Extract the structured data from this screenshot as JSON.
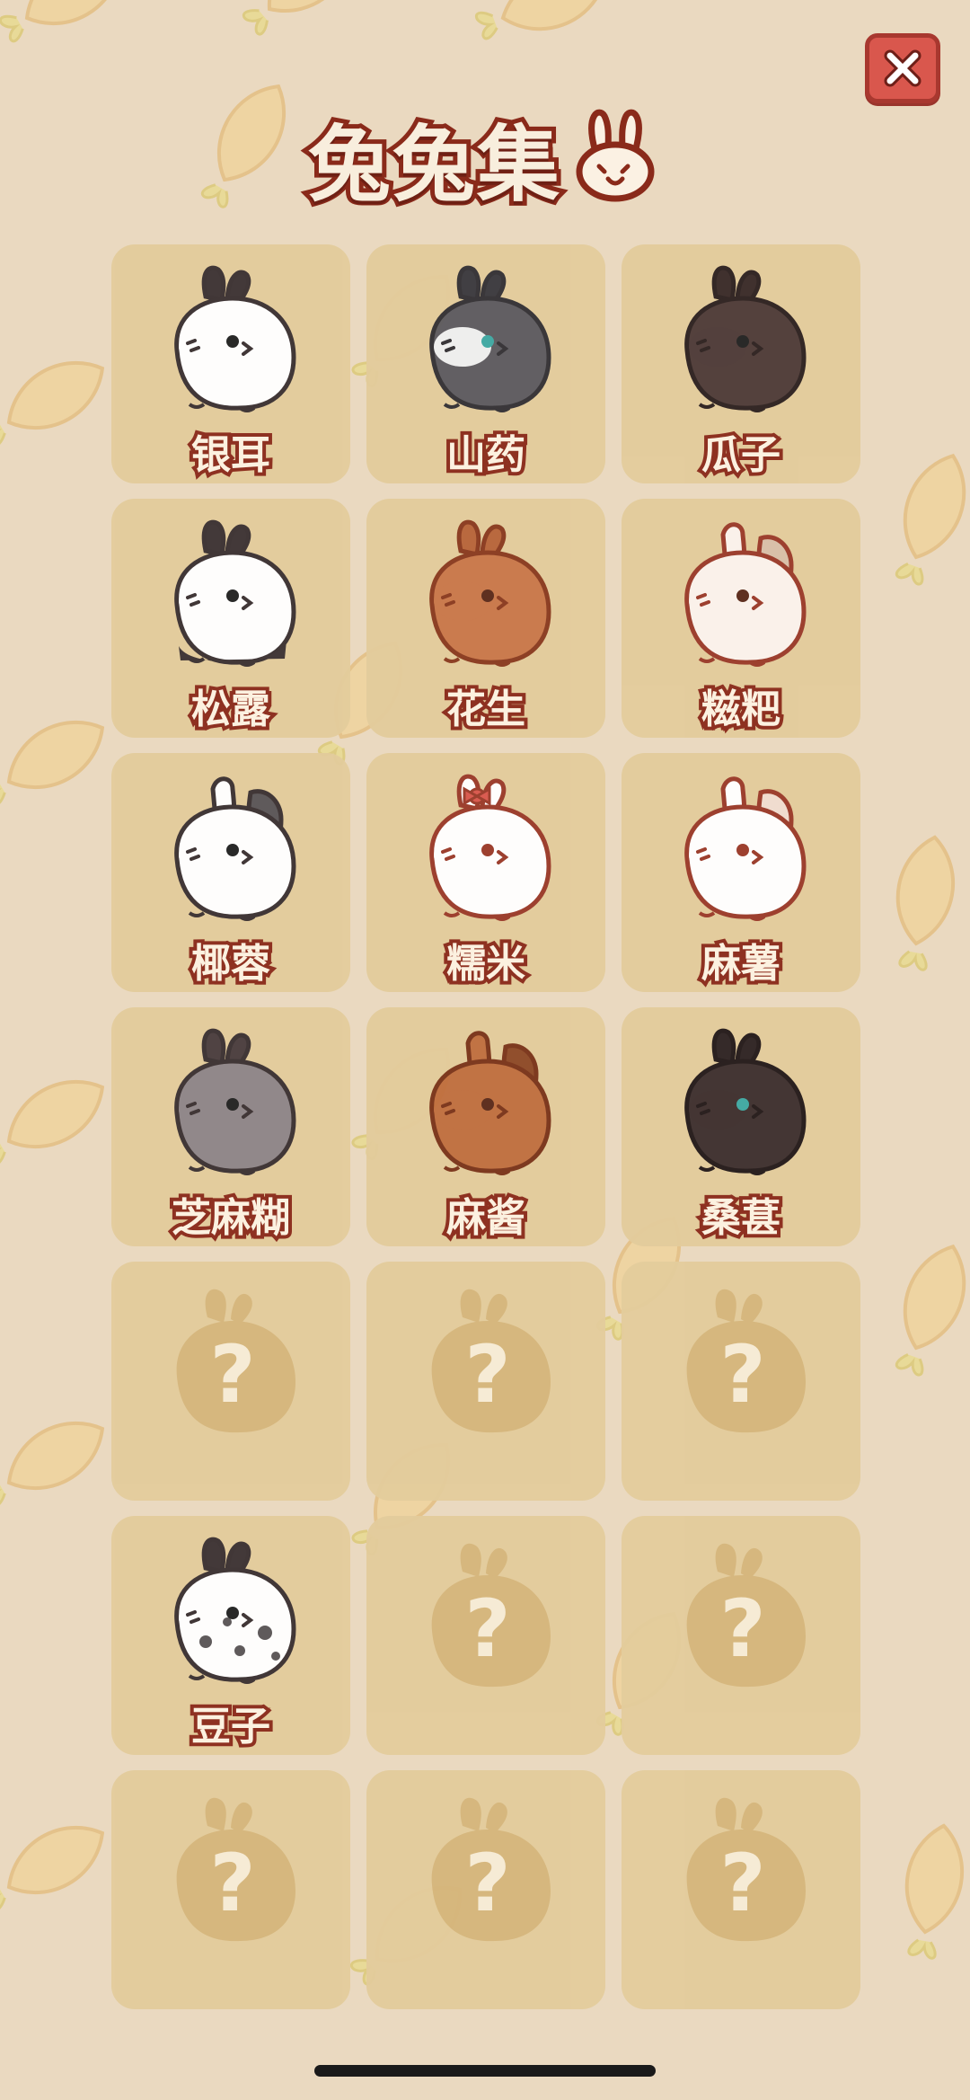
{
  "title": "兔兔集",
  "bunnies": [
    {
      "name": "银耳",
      "unlocked": true,
      "body": "#ffffff",
      "ears": "#3d3334",
      "eye": "#222222",
      "dark_lower": false,
      "lop": false,
      "bow": false,
      "spots": false,
      "outline": "#3b3132"
    },
    {
      "name": "山药",
      "unlocked": true,
      "body": "#5d5b60",
      "ears": "#3b393e",
      "eye": "#3fa9a3",
      "face": "#ffffff",
      "dark_lower": false,
      "lop": false,
      "bow": false,
      "spots": false,
      "outline": "#333135"
    },
    {
      "name": "瓜子",
      "unlocked": true,
      "body": "#4e3b38",
      "ears": "#3a2b29",
      "eye": "#222222",
      "dark_lower": false,
      "lop": false,
      "bow": false,
      "spots": false,
      "outline": "#2d2120"
    },
    {
      "name": "松露",
      "unlocked": true,
      "body": "#ffffff",
      "ears": "#3d3334",
      "eye": "#222222",
      "dark_lower": true,
      "lop": false,
      "bow": false,
      "spots": false,
      "outline": "#3b3132"
    },
    {
      "name": "花生",
      "unlocked": true,
      "body": "#c9784a",
      "ears": "#b8653a",
      "eye": "#5a2a1a",
      "dark_lower": false,
      "lop": false,
      "bow": false,
      "spots": false,
      "outline": "#8a3a1f"
    },
    {
      "name": "糍粑",
      "unlocked": true,
      "body": "#fbf3ec",
      "ears": "#d9bfa9",
      "eye": "#5a2a1a",
      "dark_lower": false,
      "lop": true,
      "bow": false,
      "spots": false,
      "outline": "#9a3a2a"
    },
    {
      "name": "椰蓉",
      "unlocked": true,
      "body": "#ffffff",
      "ears": "#5a5557",
      "eye": "#222222",
      "dark_lower": false,
      "lop": true,
      "bow": false,
      "spots": false,
      "outline": "#3b3132"
    },
    {
      "name": "糯米",
      "unlocked": true,
      "body": "#ffffff",
      "ears": "#ffffff",
      "eye": "#9a3a2a",
      "dark_lower": false,
      "lop": false,
      "bow": true,
      "spots": false,
      "outline": "#9a3a2a"
    },
    {
      "name": "麻薯",
      "unlocked": true,
      "body": "#ffffff",
      "ears": "#f1ddd0",
      "eye": "#9a3a2a",
      "dark_lower": false,
      "lop": true,
      "bow": false,
      "spots": false,
      "outline": "#9a3a2a"
    },
    {
      "name": "芝麻糊",
      "unlocked": true,
      "body": "#8e8588",
      "ears": "#4a3d3e",
      "eye": "#222222",
      "dark_lower": false,
      "lop": false,
      "bow": false,
      "spots": false,
      "outline": "#3b3132"
    },
    {
      "name": "麻酱",
      "unlocked": true,
      "body": "#c06f3f",
      "ears": "#8e4a28",
      "eye": "#5a2a1a",
      "dark_lower": false,
      "lop": true,
      "bow": false,
      "spots": false,
      "outline": "#7a341a"
    },
    {
      "name": "桑葚",
      "unlocked": true,
      "body": "#3e302f",
      "ears": "#2e2323",
      "eye": "#3fa9a3",
      "dark_lower": false,
      "lop": false,
      "bow": false,
      "spots": false,
      "outline": "#241a1a"
    },
    {
      "name": "",
      "unlocked": false
    },
    {
      "name": "",
      "unlocked": false
    },
    {
      "name": "",
      "unlocked": false
    },
    {
      "name": "豆子",
      "unlocked": true,
      "body": "#ffffff",
      "ears": "#3d3334",
      "eye": "#222222",
      "dark_lower": false,
      "lop": false,
      "bow": false,
      "spots": true,
      "outline": "#3b3132"
    },
    {
      "name": "",
      "unlocked": false
    },
    {
      "name": "",
      "unlocked": false
    },
    {
      "name": "",
      "unlocked": false
    },
    {
      "name": "",
      "unlocked": false
    },
    {
      "name": "",
      "unlocked": false
    }
  ],
  "locked_mark": "?"
}
